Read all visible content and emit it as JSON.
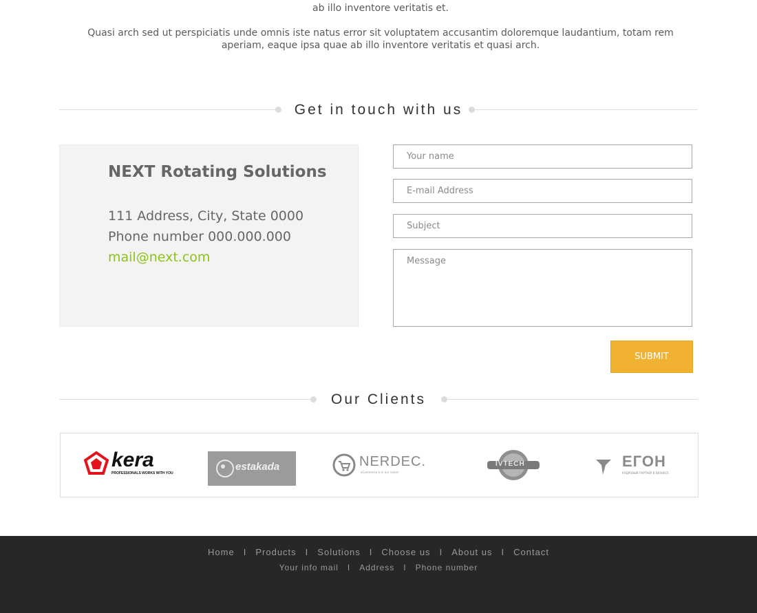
{
  "intro": {
    "para1_tail": "ab illo inventore veritatis et.",
    "para2": "Quasi arch sed ut perspiciatis unde omnis iste natus error sit voluptatem accusantim doloremque laudantium, totam rem aperiam, eaque ipsa quae ab illo inventore veritatis et quasi arch."
  },
  "contact_section": {
    "title": "Get in touch with us"
  },
  "contact_info": {
    "company": "NEXT Rotating Solutions",
    "address": "111 Address, City, State 0000",
    "phone": "Phone number 000.000.000",
    "email": "mail@next.com"
  },
  "form": {
    "name_placeholder": "Your name",
    "email_placeholder": "E-mail Address",
    "subject_placeholder": "Subject",
    "message_placeholder": "Message",
    "submit_label": "SUBMIT"
  },
  "clients_section": {
    "title": "Our Clients",
    "logos": [
      {
        "name": "kera",
        "text": "kera",
        "tagline": "PROFESSIONALS WORKS WITH YOU"
      },
      {
        "name": "estakada",
        "text": "estakada"
      },
      {
        "name": "nerdec",
        "text": "NERDEC.",
        "tagline": "eCommerce is in our name!"
      },
      {
        "name": "itech",
        "text": "IVTECH"
      },
      {
        "name": "egon",
        "text": "ЕГОН",
        "tagline": "КАДРОВЫЙ ПАРТНЕР В БИЗНЕСЕ"
      }
    ]
  },
  "footer": {
    "nav": [
      "Home",
      "Products",
      "Solutions",
      "Choose us",
      "About us",
      "Contact"
    ],
    "info": [
      "Your info mail",
      "Address",
      "Phone number"
    ],
    "separator": "I"
  },
  "colors": {
    "accent_green": "#8cc21e",
    "submit_orange": "#f1b232",
    "footer_bg": "#282627"
  }
}
